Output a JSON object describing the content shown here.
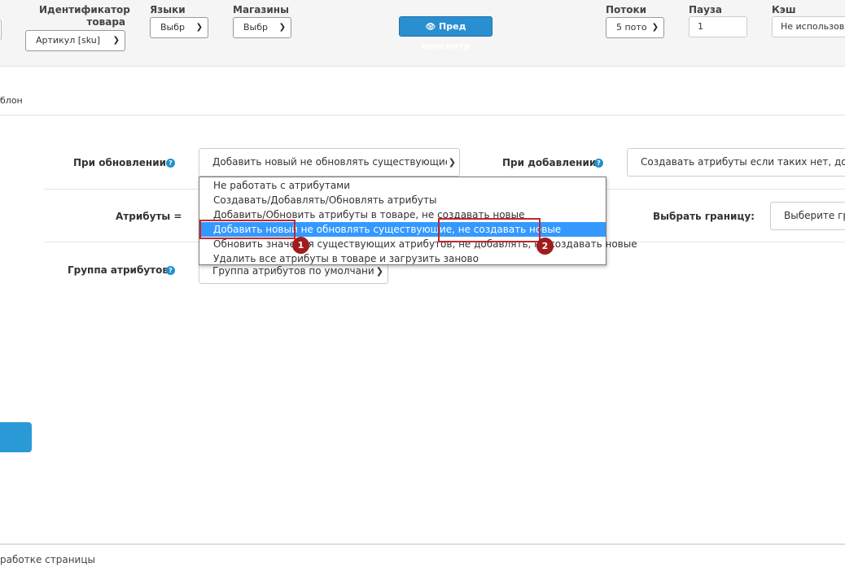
{
  "toolbar": {
    "product_id_label_line1": "Идентификатор",
    "product_id_label_line2": "товара",
    "product_id_value": "Артикул [sku]",
    "languages_label": "Языки",
    "languages_value": "Выбр",
    "stores_label": "Магазины",
    "stores_value": "Выбр",
    "preview_label": "Пред просмотр",
    "threads_label": "Потоки",
    "threads_value": "5 пото",
    "pause_label": "Пауза",
    "pause_value": "1",
    "cache_label": "Кэш",
    "cache_value": "Не использова"
  },
  "tab": {
    "label": "блон"
  },
  "form": {
    "on_update_label": "При обновлении:",
    "on_update_value": "Добавить новый не обновлять существующие",
    "on_add_label": "При добавлении:",
    "on_add_value": "Создавать атрибуты если таких нет, добав",
    "attributes_label": "Атрибуты =",
    "select_boundary_label": "Выбрать границу:",
    "select_boundary_value": "Выберите гр",
    "attr_group_label": "Группа атрибутов",
    "attr_group_value": "Группа атрибутов по умолчани"
  },
  "dropdown": {
    "options": [
      "Не работать с атрибутами",
      "Создавать/Добавлять/Обновлять атрибуты",
      "Добавить/Обновить атрибуты в товаре, не создавать новые",
      "Добавить новый не обновлять существующие, не создавать новые",
      "Обновить значения существующих атрибутов, не добавлять, не создавать новые",
      "Удалить все атрибуты в товаре и загрузить заново"
    ],
    "selected_index": 3
  },
  "annotations": {
    "marker1": "1",
    "marker2": "2"
  },
  "footer": {
    "text": "работке страницы"
  },
  "colors": {
    "accent": "#2a8fd1",
    "selected": "#3399ff",
    "highlight_red": "#c0272d"
  },
  "icons": {
    "preview": "eye-icon",
    "help": "help-circle-icon",
    "dropdown": "chevron-down-icon"
  }
}
